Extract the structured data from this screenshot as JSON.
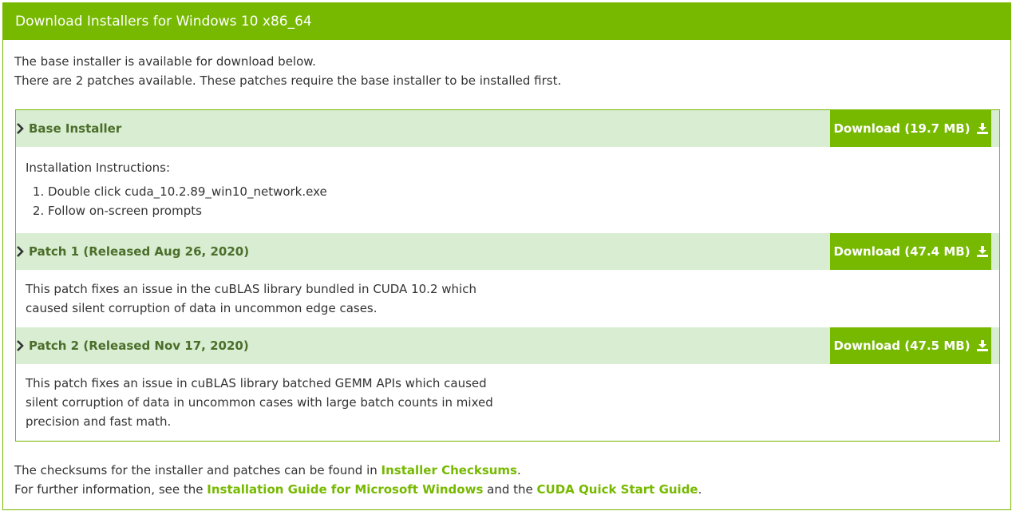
{
  "header": {
    "title": "Download Installers for Windows 10 x86_64"
  },
  "intro": {
    "line1": "The base installer is available for download below.",
    "line2": "There are 2 patches available. These patches require the base installer to be installed first."
  },
  "sections": [
    {
      "title": "Base Installer",
      "download_label": "Download (19.7 MB)",
      "body_heading": "Installation Instructions:",
      "steps": [
        "Double click cuda_10.2.89_win10_network.exe",
        "Follow on-screen prompts"
      ]
    },
    {
      "title": "Patch 1 (Released Aug 26, 2020)",
      "download_label": "Download (47.4 MB)",
      "body_lines": [
        "This patch fixes an issue in the cuBLAS library bundled in CUDA 10.2 which",
        "caused silent corruption of data in uncommon edge cases."
      ]
    },
    {
      "title": "Patch 2 (Released Nov 17, 2020)",
      "download_label": "Download (47.5 MB)",
      "body_lines": [
        "This patch fixes an issue in cuBLAS library batched GEMM APIs which caused",
        "silent corruption of data in uncommon cases with large batch counts in mixed",
        "precision and fast math."
      ]
    }
  ],
  "footer": {
    "line1_prefix": "The checksums for the installer and patches can be found in ",
    "line1_link": "Installer Checksums",
    "line1_suffix": ".",
    "line2_prefix": "For further information, see the ",
    "line2_link1": "Installation Guide for Microsoft Windows",
    "line2_mid": " and the ",
    "line2_link2": "CUDA Quick Start Guide",
    "line2_suffix": "."
  },
  "colors": {
    "accent": "#76b900",
    "section_bg": "#d8edd2",
    "section_title": "#4b6e2a"
  },
  "icons": {
    "expand": "chevron-right-icon",
    "download": "download-icon"
  }
}
